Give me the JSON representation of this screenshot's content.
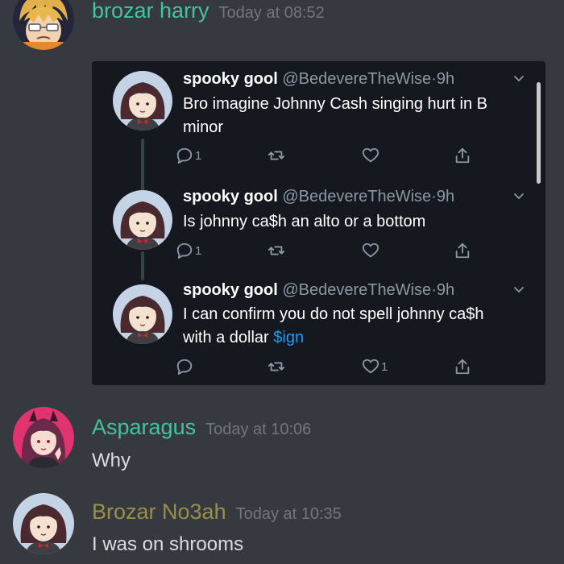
{
  "messages": [
    {
      "author": "brozar harry",
      "author_color": "#3fc79a",
      "time": "Today at 08:52",
      "embed": {
        "tweets": [
          {
            "name": "spooky gool",
            "handle": "@BedevereTheWise",
            "dot": "·",
            "age": "9h",
            "line1": "Bro imagine Johnny Cash singing hurt in B",
            "line2": "minor",
            "reply_count": "1",
            "retweet_count": "",
            "like_count": ""
          },
          {
            "name": "spooky gool",
            "handle": "@BedevereTheWise",
            "dot": "·",
            "age": "9h",
            "line1": "Is johnny ca$h an alto or a bottom",
            "reply_count": "1",
            "retweet_count": "",
            "like_count": ""
          },
          {
            "name": "spooky gool",
            "handle": "@BedevereTheWise",
            "dot": "·",
            "age": "9h",
            "line1": "I can confirm you do not spell johnny ca$h",
            "line2_prefix": "with a dollar ",
            "line2_link": "$ign",
            "reply_count": "",
            "retweet_count": "",
            "like_count": "1"
          }
        ]
      }
    },
    {
      "author": "Asparagus",
      "author_color": "#3fc79a",
      "time": "Today at 10:06",
      "text": "Why"
    },
    {
      "author": "Brozar No3ah",
      "author_color": "#9a8f4a",
      "time": "Today at 10:35",
      "text": "I was on shrooms"
    }
  ],
  "icons": {
    "reply": "reply-icon",
    "retweet": "retweet-icon",
    "like": "heart-icon",
    "share": "share-icon",
    "menu": "chevron-down-icon"
  }
}
